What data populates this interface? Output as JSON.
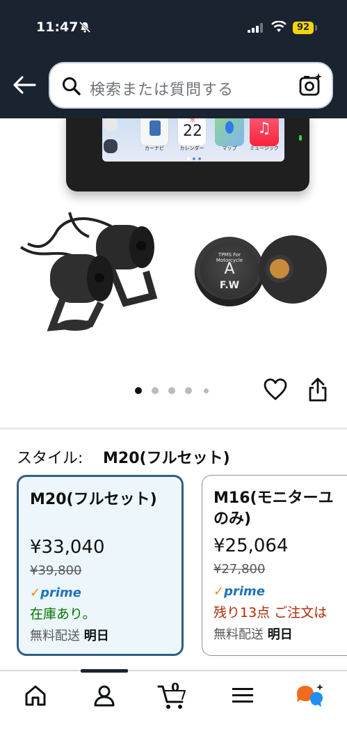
{
  "status_bar": {
    "time": "11:47",
    "battery": "92"
  },
  "search": {
    "placeholder": "検索または質問する"
  },
  "product": {
    "screen_apps": [
      "カーナビ",
      "カレンダー",
      "マップ",
      "ミュージック"
    ],
    "calendar_day": "22",
    "calendar_weekday": "水",
    "sensor_text": "TPMS For Motorcycle",
    "sensor_letter": "A",
    "sensor_position": "F.W"
  },
  "pager": {
    "count": 5,
    "active": 0
  },
  "style_selector": {
    "label": "スタイル:",
    "selected": "M20(フルセット)",
    "options": [
      {
        "name": "M20(フルセット)",
        "price": "¥33,040",
        "list_price": "¥39,800",
        "prime": "prime",
        "stock": "在庫あり。",
        "shipping_label": "無料配送",
        "shipping_day": "明日"
      },
      {
        "name_line1": "M16(モニターユ",
        "name_line2": "のみ)",
        "price": "¥25,064",
        "list_price": "¥27,800",
        "prime": "prime",
        "stock": "残り13点 ご注文は",
        "shipping_label": "無料配送",
        "shipping_day": "明日"
      }
    ]
  },
  "tabbar": {
    "cart_count": "0",
    "items": [
      "home-icon",
      "account-icon",
      "cart-icon",
      "menu-icon",
      "rufus-icon"
    ]
  },
  "colors": {
    "header": "#1a2430",
    "selected_border": "#2d5f83",
    "in_stock": "#007600",
    "low_stock": "#b12704",
    "prime_blue": "#1f73b7",
    "battery": "#f5d40b"
  }
}
